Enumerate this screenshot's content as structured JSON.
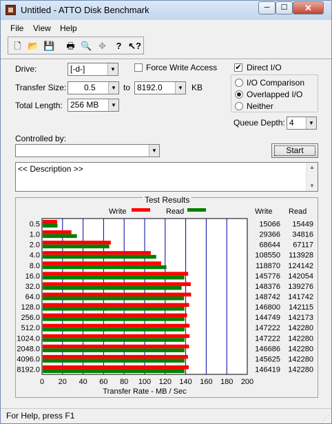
{
  "window": {
    "title": "Untitled - ATTO Disk Benchmark"
  },
  "menu": {
    "items": [
      "File",
      "View",
      "Help"
    ]
  },
  "toolbar": {
    "icons": [
      "new-file-icon",
      "open-folder-icon",
      "save-icon",
      "print-icon",
      "print-preview-icon",
      "move-icon",
      "help-icon",
      "context-help-icon"
    ]
  },
  "form": {
    "drive_label": "Drive:",
    "drive_value": "[-d-]",
    "force_write_label": "Force Write Access",
    "force_write_checked": false,
    "direct_io_label": "Direct I/O",
    "direct_io_checked": true,
    "transfer_size_label": "Transfer Size:",
    "transfer_from": "0.5",
    "to_label": "to",
    "transfer_to": "8192.0",
    "kb_label": "KB",
    "total_length_label": "Total Length:",
    "total_length_value": "256 MB",
    "radio_options": [
      "I/O Comparison",
      "Overlapped I/O",
      "Neither"
    ],
    "radio_selected": 1,
    "queue_depth_label": "Queue Depth:",
    "queue_depth_value": "4",
    "controlled_by_label": "Controlled by:",
    "controlled_by_value": "",
    "start_label": "Start",
    "description_text": "<< Description >>"
  },
  "chart_data": {
    "type": "bar",
    "orientation": "horizontal",
    "title": "Test Results",
    "xlabel": "Transfer Rate - MB / Sec",
    "xlim": [
      0,
      200
    ],
    "xticks": [
      "0",
      "20",
      "40",
      "60",
      "80",
      "100",
      "120",
      "140",
      "160",
      "180",
      "200"
    ],
    "categories": [
      "0.5",
      "1.0",
      "2.0",
      "4.0",
      "8.0",
      "16.0",
      "32.0",
      "64.0",
      "128.0",
      "256.0",
      "512.0",
      "1024.0",
      "2048.0",
      "4096.0",
      "8192.0"
    ],
    "series": [
      {
        "name": "Write",
        "color": "#ff0000",
        "values": [
          15066,
          29366,
          68644,
          108550,
          118870,
          145776,
          148376,
          148742,
          146800,
          144749,
          147222,
          147222,
          146686,
          145625,
          146419
        ]
      },
      {
        "name": "Read",
        "color": "#008000",
        "values": [
          15449,
          34816,
          67117,
          113928,
          124142,
          142054,
          139276,
          141742,
          142115,
          142173,
          142280,
          142280,
          142280,
          142280,
          142280
        ]
      }
    ],
    "value_unit_note": "KB/s",
    "table_headers": [
      "Write",
      "Read"
    ],
    "gridlines_color": "#0000a0",
    "legend": "top"
  },
  "status": {
    "text": "For Help, press F1"
  }
}
